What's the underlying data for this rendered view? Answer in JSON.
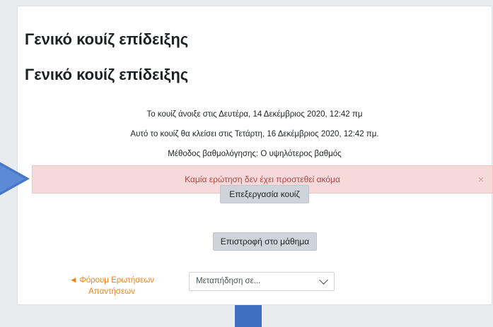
{
  "page": {
    "title_primary": "Γενικό κουίζ επίδειξης",
    "title_secondary": "Γενικό κουίζ επίδειξης"
  },
  "quiz_info": {
    "opened": "Το κουίζ άνοιξε στις Δευτέρα, 14 Δεκέμβριος 2020, 12:42 πμ",
    "closes": "Αυτό το κουίζ θα κλείσει στις Τετάρτη, 16 Δεκέμβριος 2020, 12:42 πμ.",
    "grading_method": "Μέθοδος βαθμολόγησης: Ο υψηλότερος βαθμός"
  },
  "alert": {
    "message": "Καμία ερώτηση δεν έχει προστεθεί ακόμα",
    "close_symbol": "×"
  },
  "actions": {
    "edit_quiz": "Επεξεργασία κουίζ",
    "return_course": "Επιστροφή στο μάθημα"
  },
  "navigation": {
    "prev_link": "◄ Φόρουμ Ερωτήσεων Απαντήσεων",
    "jump_placeholder": "Μεταπήδηση σε..."
  },
  "colors": {
    "link_accent": "#f98012",
    "alert_bg": "#f6d9d9",
    "alert_text": "#b54545",
    "pointer": "#4a78c8"
  },
  "icons": {
    "pointer": "arrow-right-icon",
    "close": "close-icon",
    "dropdown": "chevron-down-icon"
  }
}
